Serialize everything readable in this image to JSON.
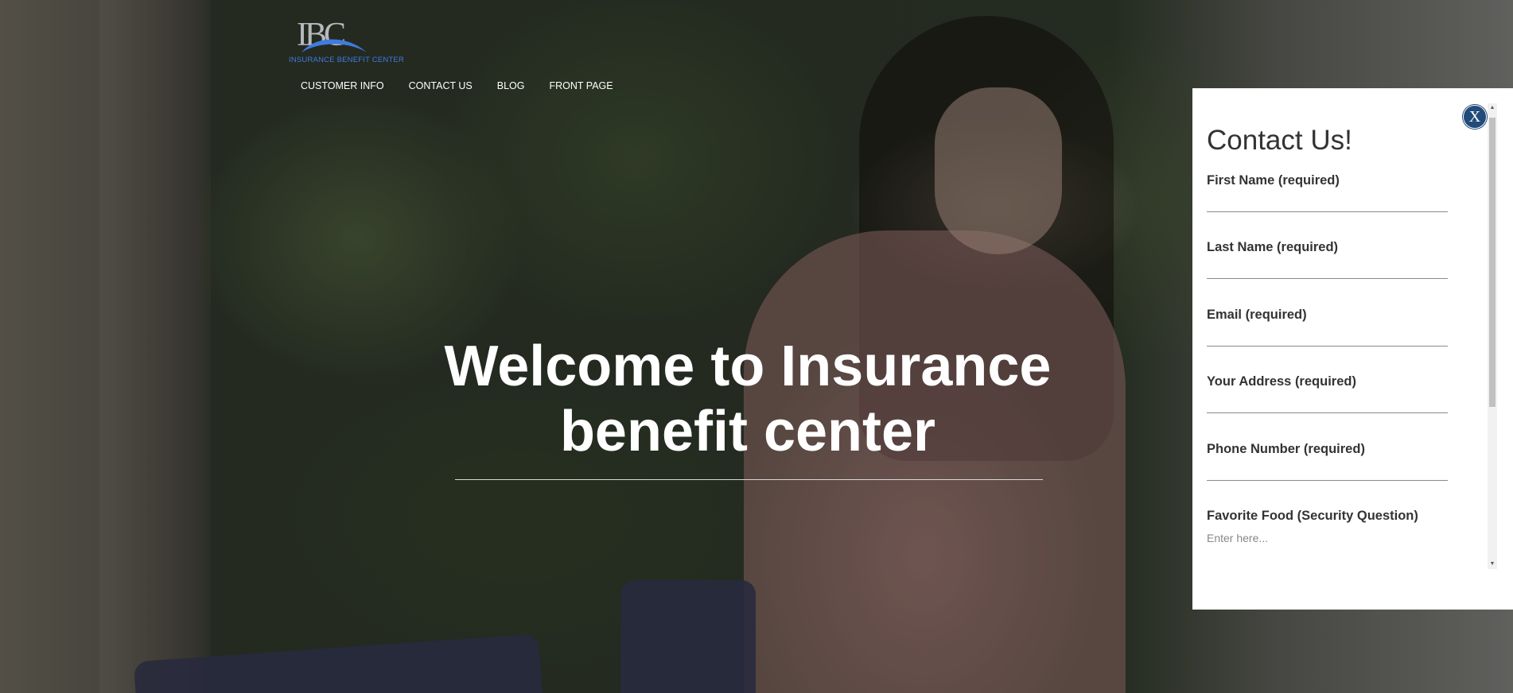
{
  "brand": {
    "logo_letters": "IBC",
    "logo_subtitle": "INSURANCE BENEFIT CENTER"
  },
  "nav": [
    {
      "label": "CUSTOMER INFO"
    },
    {
      "label": "CONTACT US"
    },
    {
      "label": "BLOG"
    },
    {
      "label": "FRONT PAGE"
    }
  ],
  "hero": {
    "line1": "Welcome to Insurance",
    "line2": "benefit center"
  },
  "contact_panel": {
    "title": "Contact Us!",
    "close_label": "X",
    "fields": [
      {
        "label": "First Name (required)",
        "value": "",
        "placeholder": ""
      },
      {
        "label": "Last Name (required)",
        "value": "",
        "placeholder": ""
      },
      {
        "label": "Email (required)",
        "value": "",
        "placeholder": ""
      },
      {
        "label": "Your Address (required)",
        "value": "",
        "placeholder": ""
      },
      {
        "label": "Phone Number (required)",
        "value": "",
        "placeholder": ""
      },
      {
        "label": "Favorite Food (Security Question)",
        "value": "",
        "placeholder": "Enter here..."
      }
    ]
  },
  "colors": {
    "close_button": "#214b7a",
    "logo_blue": "#3f7be0",
    "panel_bg": "#ffffff"
  },
  "icons": {
    "close": "close-icon",
    "scroll_up": "triangle-up-icon",
    "scroll_down": "triangle-down-icon"
  }
}
